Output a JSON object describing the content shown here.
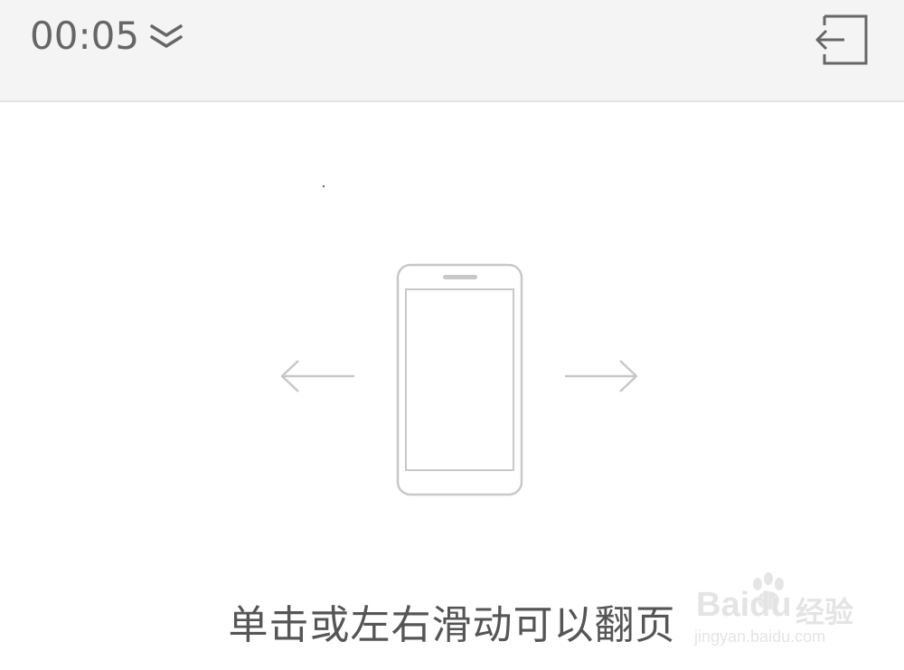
{
  "topbar": {
    "timer": "00:05",
    "collapse_icon": "double-chevron-down-icon",
    "exit_icon": "exit-reader-icon"
  },
  "illustration": {
    "icon": "phone-swipe-icon",
    "left_arrow": "arrow-left-icon",
    "right_arrow": "arrow-right-icon"
  },
  "hint": {
    "text": "单击或左右滑动可以翻页"
  },
  "watermark": {
    "brand_latin": "Bai",
    "brand_suffix": "du",
    "brand_cn": "经验",
    "url": "jingyan.baidu.com"
  },
  "colors": {
    "topbar_bg": "#f4f4f4",
    "icon_gray": "#666666",
    "illustration_gray": "#c8c8c8",
    "text_gray": "#555555"
  }
}
